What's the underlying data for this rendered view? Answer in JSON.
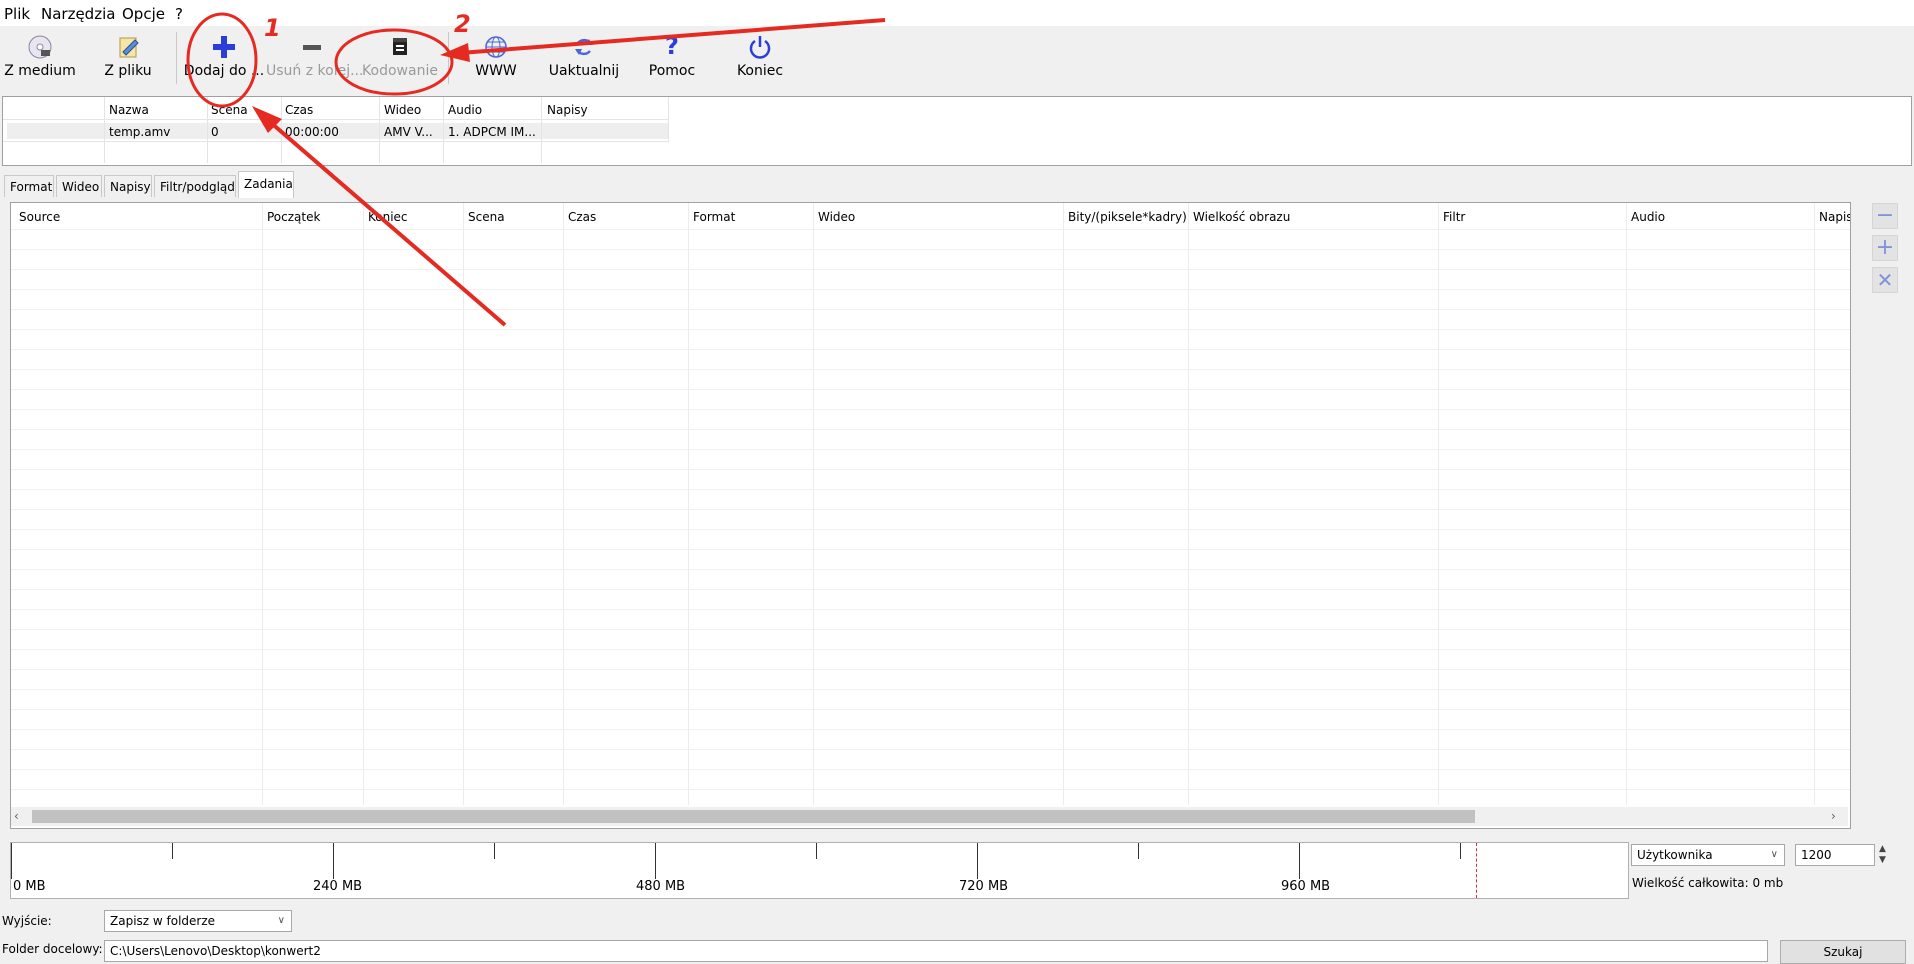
{
  "menu": [
    "Plik",
    "Narzędzia",
    "Opcje",
    "?"
  ],
  "toolbar": {
    "buttons": [
      {
        "label": "Z medium",
        "icon": "disc-icon",
        "enabled": true
      },
      {
        "label": "Z pliku",
        "icon": "file-edit-icon",
        "enabled": true
      },
      {
        "label": "Dodaj do ...",
        "icon": "plus-icon",
        "enabled": true
      },
      {
        "label": "Usuń z kolej...",
        "icon": "minus-icon",
        "enabled": false
      },
      {
        "label": "Kodowanie",
        "icon": "clapper-icon",
        "enabled": false
      },
      {
        "label": "WWW",
        "icon": "globe-icon",
        "enabled": true
      },
      {
        "label": "Uaktualnij",
        "icon": "refresh-icon",
        "enabled": true
      },
      {
        "label": "Pomoc",
        "icon": "question-icon",
        "enabled": true
      },
      {
        "label": "Koniec",
        "icon": "power-icon",
        "enabled": true
      }
    ]
  },
  "source_table": {
    "headers": [
      "Nazwa",
      "Scena",
      "Czas",
      "Wideo",
      "Audio",
      "Napisy"
    ],
    "rows": [
      [
        "temp.amv",
        "0",
        "00:00:00",
        "AMV V...",
        "1. ADPCM IM...",
        ""
      ]
    ]
  },
  "tabs": [
    "Format",
    "Wideo",
    "Napisy",
    "Filtr/podgląd",
    "Zadania"
  ],
  "active_tab": "Zadania",
  "jobs_table": {
    "headers": [
      "Source",
      "Początek",
      "Koniec",
      "Scena",
      "Czas",
      "Format",
      "Wideo",
      "Bity/(piksele*kadry)",
      "Wielkość obrazu",
      "Filtr",
      "Audio",
      "Napisy"
    ],
    "rows": []
  },
  "side_buttons": [
    "minus-icon",
    "plus-icon",
    "close-icon"
  ],
  "size_bar": {
    "labels": [
      "0 MB",
      "240 MB",
      "480 MB",
      "720 MB",
      "960 MB"
    ],
    "target_mb": 1200
  },
  "size_controls": {
    "mode": "Użytkownika",
    "value": "1200",
    "total_label": "Wielkość całkowita: 0 mb"
  },
  "output": {
    "label": "Wyjście:",
    "mode": "Zapisz w folderze",
    "folder_label": "Folder docelowy:",
    "folder_path": "C:\\Users\\Lenovo\\Desktop\\konwert2",
    "search_button": "Szukaj"
  },
  "annotations": [
    "1",
    "2"
  ],
  "colors": {
    "accent_blue": "#2b3fd8",
    "annotation_red": "#e52a22"
  }
}
